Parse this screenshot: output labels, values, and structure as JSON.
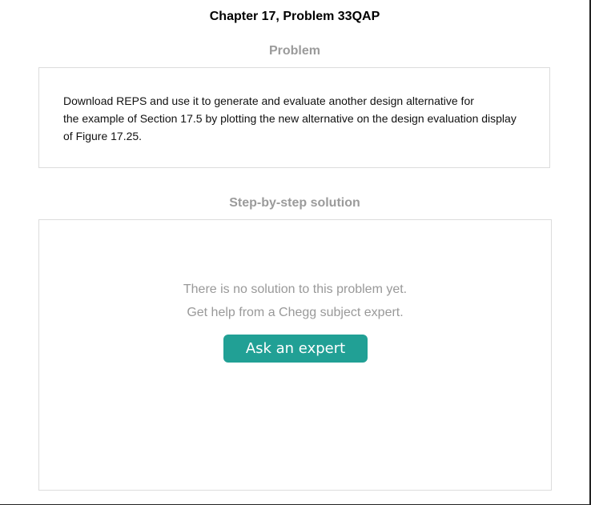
{
  "header": {
    "title": "Chapter 17, Problem 33QAP"
  },
  "problem": {
    "heading": "Problem",
    "lines": [
      "Download REPS and use it to generate and evaluate another design alternative for",
      "the example of Section 17.5 by plotting the new alternative on the design evaluation display",
      "of Figure 17.25."
    ]
  },
  "solution": {
    "heading": "Step-by-step solution",
    "no_solution_text": "There is no solution to this problem yet.",
    "help_text": "Get help from a Chegg subject expert.",
    "ask_button_label": "Ask an expert",
    "accent_color": "#21a095"
  }
}
